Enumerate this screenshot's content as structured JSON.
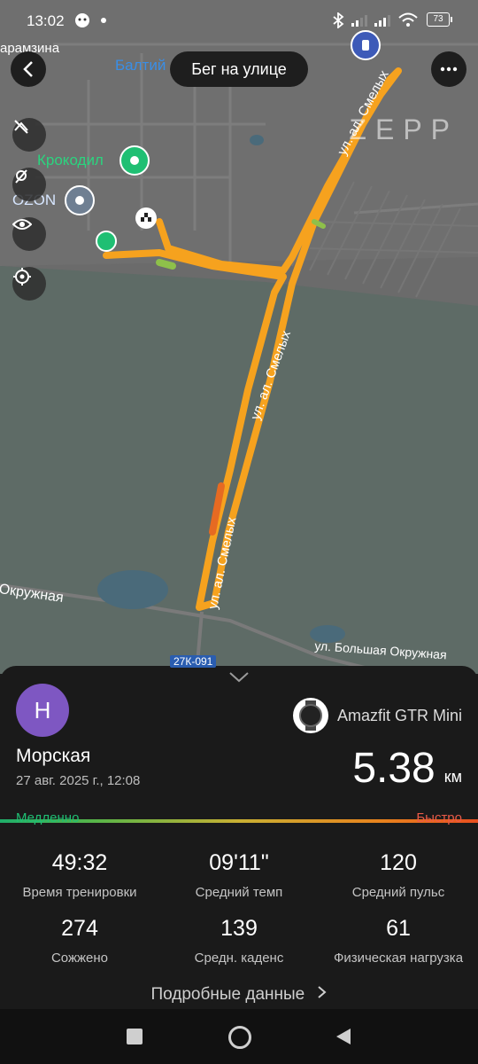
{
  "status_bar": {
    "time": "13:02",
    "battery": "73"
  },
  "header": {
    "title": "Бег на улице",
    "back_icon": "back-arrow-icon",
    "more_icon": "more-icon"
  },
  "map": {
    "brand": "ZEPP",
    "labels": {
      "karamzina": "арамзина",
      "baltiy": "Балтий",
      "krokodil": "Крокодил",
      "ozon": "OZON",
      "street1": "ул. ал. Смелых",
      "street2": "ул. ал. Смелых",
      "street3": "ул. ал. Смелых",
      "okruzhnaya": "Окружная",
      "bolshaya": "ул. Большая Окружная",
      "road_code": "27К-091"
    },
    "route_color": "#f6a21e",
    "water_color": "#4a6a7a"
  },
  "summary": {
    "avatar_letter": "Н",
    "avatar_color": "#7e57c2",
    "device_name": "Amazfit GTR Mini",
    "location": "Морская",
    "date": "27 авг. 2025 г., 12:08",
    "distance": "5.38",
    "distance_unit": "км",
    "pace_slow": "Медленно",
    "pace_fast": "Быстро",
    "stats": [
      {
        "value": "49:32",
        "label": "Время тренировки"
      },
      {
        "value": "09'11\"",
        "label": "Средний темп"
      },
      {
        "value": "120",
        "label": "Средний пульс"
      },
      {
        "value": "274",
        "label": "Сожжено"
      },
      {
        "value": "139",
        "label": "Средн. каденс"
      },
      {
        "value": "61",
        "label": "Физическая нагрузка"
      }
    ],
    "details_link": "Подробные данные"
  }
}
